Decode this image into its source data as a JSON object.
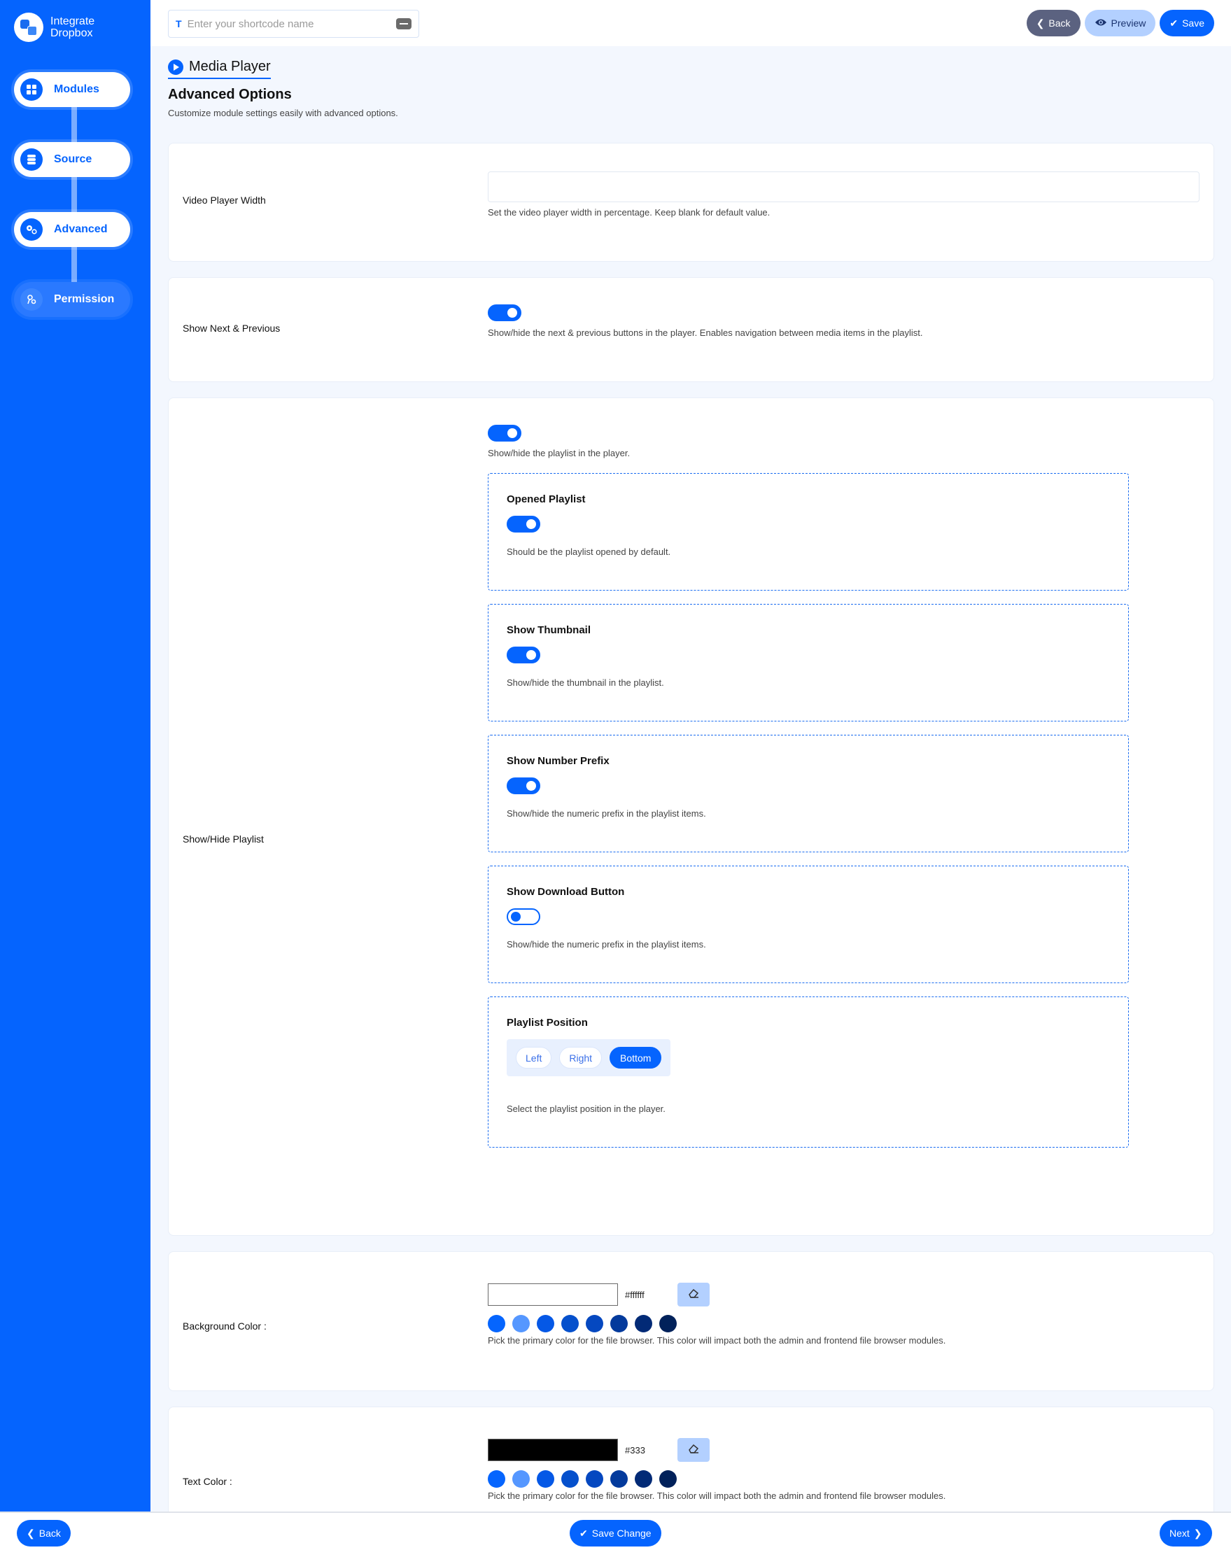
{
  "app": {
    "name_line1": "Integrate",
    "name_line2": "Dropbox"
  },
  "sidebar": {
    "items": [
      {
        "label": "Modules",
        "icon": "grid-icon",
        "active": true
      },
      {
        "label": "Source",
        "icon": "database-icon",
        "active": true
      },
      {
        "label": "Advanced",
        "icon": "gears-icon",
        "active": true
      },
      {
        "label": "Permission",
        "icon": "key-icon",
        "active": false
      }
    ]
  },
  "topbar": {
    "shortcode_prefix": "T",
    "shortcode_placeholder": "Enter your shortcode name",
    "shortcode_value": "",
    "back_label": "Back",
    "preview_label": "Preview",
    "save_label": "Save"
  },
  "header": {
    "module_title": "Media Player",
    "section_title": "Advanced Options",
    "section_subtitle": "Customize module settings easily with advanced options."
  },
  "settings": {
    "video_width": {
      "label": "Video Player Width",
      "value": "",
      "description": "Set the video player width in percentage. Keep blank for default value."
    },
    "next_prev": {
      "label": "Show Next & Previous",
      "enabled": true,
      "description": "Show/hide the next & previous buttons in the player. Enables navigation between media items in the playlist."
    },
    "playlist": {
      "label": "Show/Hide Playlist",
      "enabled": true,
      "description": "Show/hide the playlist in the player.",
      "opened": {
        "title": "Opened Playlist",
        "enabled": true,
        "description": "Should be the playlist opened by default."
      },
      "thumbnail": {
        "title": "Show Thumbnail",
        "enabled": true,
        "description": "Show/hide the thumbnail in the playlist."
      },
      "number_prefix": {
        "title": "Show Number Prefix",
        "enabled": true,
        "description": "Show/hide the numeric prefix in the playlist items."
      },
      "download": {
        "title": "Show Download Button",
        "enabled": false,
        "description": "Show/hide the numeric prefix in the playlist items."
      },
      "position": {
        "title": "Playlist Position",
        "options": [
          "Left",
          "Right",
          "Bottom"
        ],
        "selected": "Bottom",
        "description": "Select the playlist position in the player."
      }
    },
    "background_color": {
      "label": "Background Color :",
      "value": "#ffffff",
      "preview": "#ffffff",
      "description": "Pick the primary color for the file browser. This color will impact both the admin and frontend file browser modules."
    },
    "text_color": {
      "label": "Text Color :",
      "value": "#333",
      "preview": "#000000",
      "description": "Pick the primary color for the file browser. This color will impact both the admin and frontend file browser modules."
    },
    "swatches": [
      "#0565fe",
      "#5597ff",
      "#0558e6",
      "#0550cc",
      "#0548c0",
      "#033a9c",
      "#022a76",
      "#01215a"
    ]
  },
  "footer": {
    "back_label": "Back",
    "save_label": "Save Change",
    "next_label": "Next"
  },
  "colors": {
    "primary": "#0564fe",
    "sidebar": "#0564fe",
    "background": "#f3f7fe"
  }
}
